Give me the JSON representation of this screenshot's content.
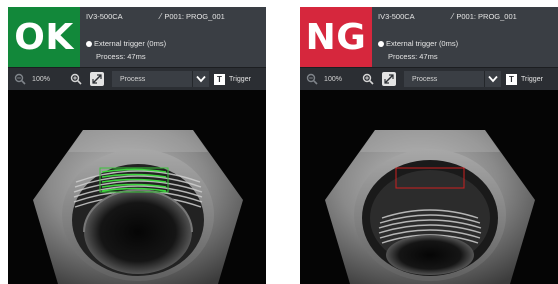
{
  "panels": [
    {
      "result": "OK",
      "result_color": "#12883a",
      "model": "IV3-500CA",
      "program": "P001: PROG_001",
      "trigger_text": "External trigger (0ms)",
      "process_text": "Process: 47ms",
      "toolbar": {
        "zoom_level": "100%",
        "mode": "Process",
        "trigger_label": "Trigger",
        "trigger_icon_letter": "T",
        "icons": [
          "zoom-out-icon",
          "zoom-in-icon",
          "fit-to-screen-icon",
          "chevron-down-icon"
        ]
      },
      "roi_color": "#39c439"
    },
    {
      "result": "NG",
      "result_color": "#d6273d",
      "model": "IV3-500CA",
      "program": "P001: PROG_001",
      "trigger_text": "External trigger (0ms)",
      "process_text": "Process: 47ms",
      "toolbar": {
        "zoom_level": "100%",
        "mode": "Process",
        "trigger_label": "Trigger",
        "trigger_icon_letter": "T",
        "icons": [
          "zoom-out-icon",
          "zoom-in-icon",
          "fit-to-screen-icon",
          "chevron-down-icon"
        ]
      },
      "roi_color": "#cc2020"
    }
  ]
}
